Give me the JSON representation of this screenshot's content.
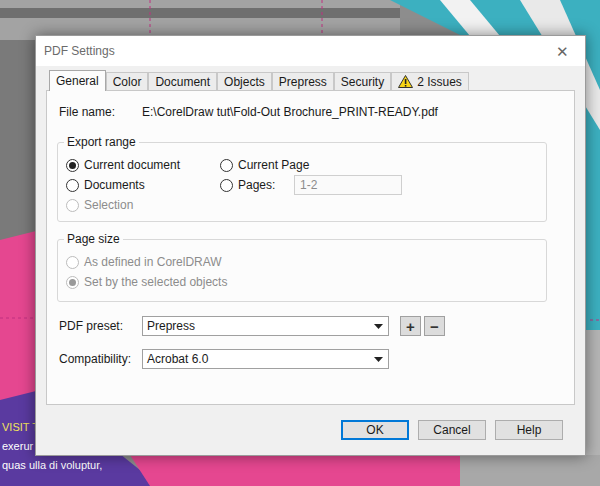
{
  "window": {
    "title": "PDF Settings",
    "close": "✕"
  },
  "tabs": [
    {
      "label": "General",
      "selected": true,
      "kind": "plain"
    },
    {
      "label": "Color",
      "selected": false,
      "kind": "plain"
    },
    {
      "label": "Document",
      "selected": false,
      "kind": "plain"
    },
    {
      "label": "Objects",
      "selected": false,
      "kind": "plain"
    },
    {
      "label": "Prepress",
      "selected": false,
      "kind": "plain"
    },
    {
      "label": "Security",
      "selected": false,
      "kind": "plain"
    },
    {
      "label": "2 Issues",
      "selected": false,
      "kind": "warning"
    }
  ],
  "file_name": {
    "label": "File name:",
    "value": "E:\\CorelDraw tut\\Fold-Out Brochure_PRINT-READY.pdf"
  },
  "export_range": {
    "title": "Export range",
    "options": [
      {
        "label": "Current document",
        "selected": true,
        "disabled": false,
        "kind": "radio"
      },
      {
        "label": "Current Page",
        "selected": false,
        "disabled": false,
        "kind": "radio"
      },
      {
        "label": "Documents",
        "selected": false,
        "disabled": false,
        "kind": "radio"
      },
      {
        "label": "Pages:",
        "selected": false,
        "disabled": false,
        "kind": "field"
      },
      {
        "label": "Selection",
        "selected": false,
        "disabled": true,
        "kind": "radio"
      }
    ],
    "pages_field": {
      "value": "1-2",
      "disabled": true
    }
  },
  "page_size": {
    "title": "Page size",
    "options": [
      {
        "label": "As defined in CorelDRAW",
        "selected": false,
        "disabled": true
      },
      {
        "label": "Set by the selected objects",
        "selected": true,
        "disabled": true
      }
    ]
  },
  "pdf_preset": {
    "label": "PDF preset:",
    "value": "Prepress",
    "add": "+",
    "remove": "−"
  },
  "compatibility": {
    "label": "Compatibility:",
    "value": "Acrobat 6.0"
  },
  "buttons": [
    {
      "label": "OK",
      "default": true
    },
    {
      "label": "Cancel",
      "default": false
    },
    {
      "label": "Help",
      "default": false
    }
  ],
  "canvas": {
    "texts": [
      {
        "text": "VISIT T",
        "color": "#f2e45c"
      },
      {
        "text": "exerur",
        "color": "#ffffff"
      },
      {
        "text": "quas ulla di voluptur,",
        "color": "#ffffff"
      }
    ]
  }
}
